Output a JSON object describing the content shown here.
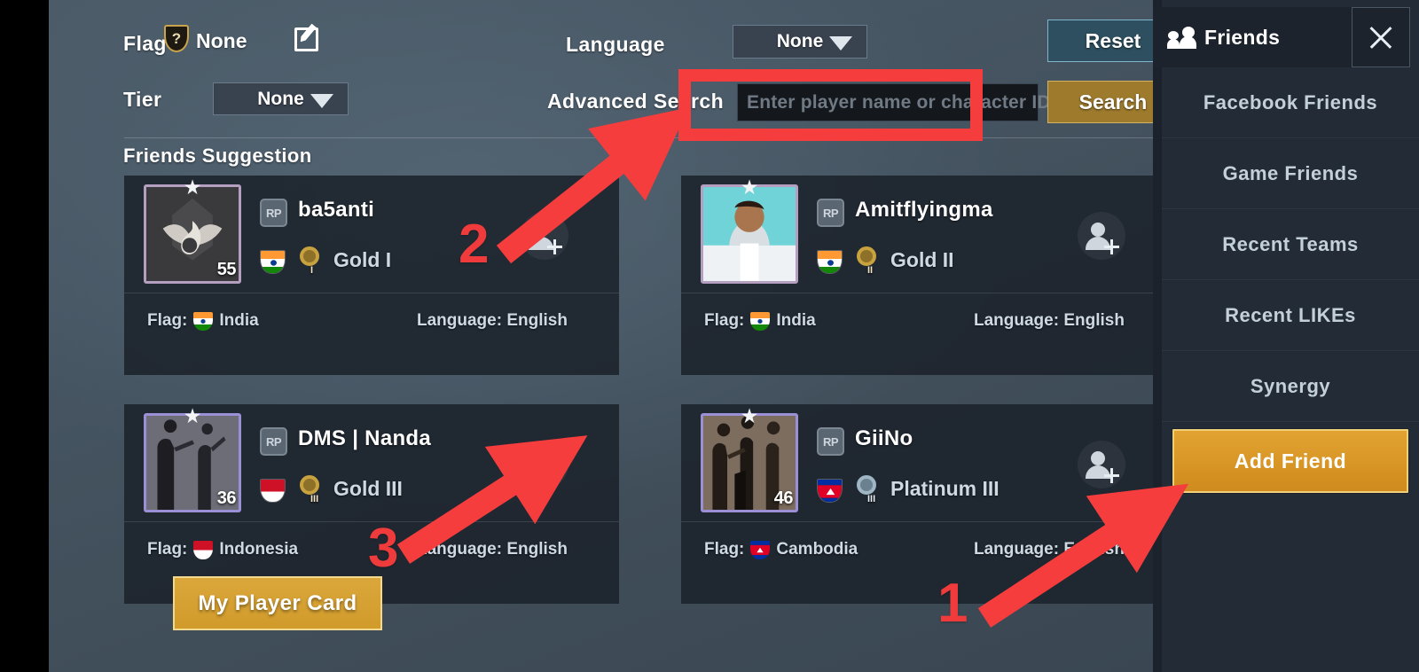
{
  "filters": {
    "flag_label": "Flag",
    "flag_value": "None",
    "flag_icon_char": "?",
    "edit_icon": "pen-edit-icon",
    "tier_label": "Tier",
    "tier_value": "None",
    "language_label": "Language",
    "language_value": "None",
    "advanced_search_label": "Advanced Search",
    "search_placeholder": "Enter player name or character ID",
    "search_value": "",
    "reset_label": "Reset",
    "search_label": "Search"
  },
  "section": {
    "suggestion_title": "Friends Suggestion",
    "my_player_card_label": "My Player Card"
  },
  "sidebar": {
    "title": "Friends",
    "title_icon": "people-icon",
    "close_icon": "close-x-icon",
    "items": [
      {
        "label": "Facebook Friends",
        "active": false
      },
      {
        "label": "Game Friends",
        "active": false
      },
      {
        "label": "Recent Teams",
        "active": false
      },
      {
        "label": "Recent LIKEs",
        "active": false
      },
      {
        "label": "Synergy",
        "active": false
      },
      {
        "label": "Add Friend",
        "active": true
      }
    ]
  },
  "cards": [
    {
      "name": "ba5anti",
      "rp_badge": "RP",
      "level": "55",
      "tier": "Gold I",
      "tier_roman": "I",
      "tier_kind": "gold",
      "flag_name": "India",
      "flag_code": "IN",
      "meta_flag_label": "Flag:",
      "meta_lang_label": "Language: English",
      "avatar_kind": "emblem",
      "frame_color": "#b59fc0",
      "add_icon": "add-friend-icon"
    },
    {
      "name": "Amitflyingma",
      "rp_badge": "RP",
      "level": "",
      "tier": "Gold II",
      "tier_roman": "II",
      "tier_kind": "gold",
      "flag_name": "India",
      "flag_code": "IN",
      "meta_flag_label": "Flag:",
      "meta_lang_label": "Language: English",
      "avatar_kind": "photo",
      "frame_color": "#b59fc0",
      "add_icon": "add-friend-icon"
    },
    {
      "name": "DMS  |  Nanda",
      "rp_badge": "RP",
      "level": "36",
      "tier": "Gold III",
      "tier_roman": "III",
      "tier_kind": "gold",
      "flag_name": "Indonesia",
      "flag_code": "ID",
      "meta_flag_label": "Flag:",
      "meta_lang_label": "Language: English",
      "avatar_kind": "duo",
      "frame_color": "#9b8fd6",
      "add_icon": "add-friend-icon"
    },
    {
      "name": "GiiNo",
      "rp_badge": "RP",
      "level": "46",
      "tier": "Platinum III",
      "tier_roman": "III",
      "tier_kind": "platinum",
      "flag_name": "Cambodia",
      "flag_code": "KH",
      "meta_flag_label": "Flag:",
      "meta_lang_label": "Language: English",
      "avatar_kind": "trio",
      "frame_color": "#9b8fd6",
      "add_icon": "add-friend-icon"
    }
  ],
  "annotations": {
    "highlight_color": "#f53d3d",
    "step_1": "1",
    "step_2": "2",
    "step_3": "3"
  },
  "colors": {
    "panel_bg": "#47566 3",
    "sidebar_bg": "#232b36",
    "accent_gold": "#dba73b",
    "accent_teal": "#2d4f5f",
    "annotation_red": "#f53d3d"
  }
}
